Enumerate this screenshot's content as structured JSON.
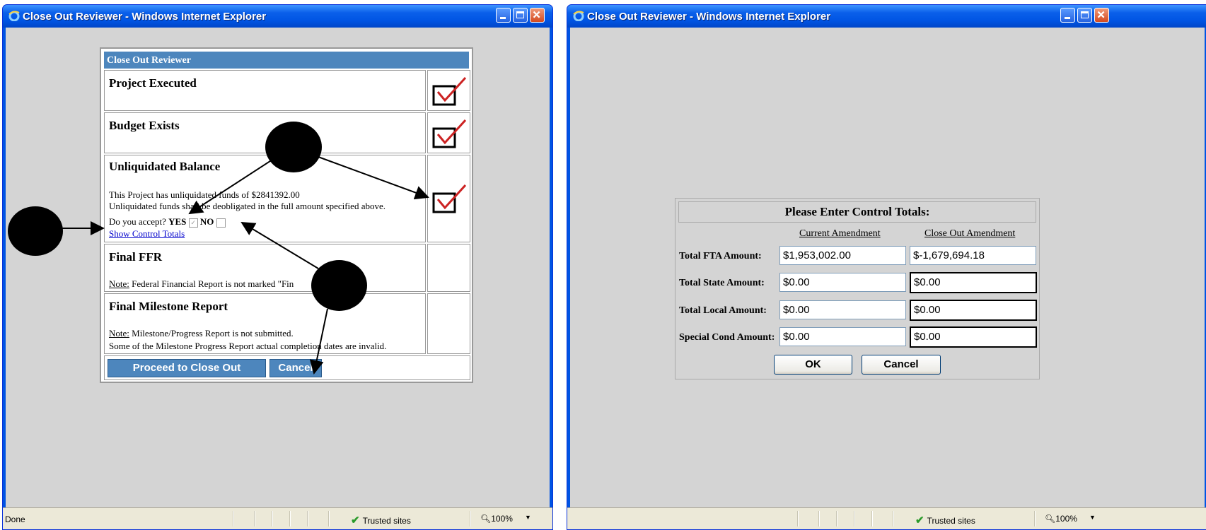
{
  "left_window": {
    "title": "Close Out Reviewer - Windows Internet Explorer",
    "dialog_header": "Close Out Reviewer",
    "rows": {
      "project_executed": "Project Executed",
      "budget_exists": "Budget Exists",
      "unliquidated_balance": "Unliquidated Balance",
      "unliquidated_text1": "This Project has unliquidated funds of $2841392.00",
      "unliquidated_text2": "Unliquidated funds shall be deobligated in the full amount specified above.",
      "accept_question": "Do you accept?",
      "yes_label": "YES",
      "no_label": "NO",
      "show_control_totals": "Show Control Totals",
      "final_ffr": "Final FFR",
      "note_label": "Note:",
      "ffr_note": "Federal Financial Report is not marked \"Fin",
      "final_milestone": "Final Milestone Report",
      "milestone_note1": "Milestone/Progress Report is not submitted.",
      "milestone_note2": "Some of the Milestone Progress Report actual completion dates are invalid."
    },
    "buttons": {
      "proceed": "Proceed to Close Out",
      "cancel": "Cancel"
    },
    "status": {
      "done": "Done",
      "zone": "Trusted sites",
      "zoom": "100%"
    }
  },
  "right_window": {
    "title": "Close Out Reviewer - Windows Internet Explorer",
    "form_title": "Please Enter Control Totals:",
    "col_current": "Current Amendment",
    "col_closeout": "Close Out Amendment",
    "rows": [
      {
        "label": "Total FTA Amount:",
        "current": "$1,953,002.00",
        "closeout": "$-1,679,694.18"
      },
      {
        "label": "Total State Amount:",
        "current": "$0.00",
        "closeout": "$0.00"
      },
      {
        "label": "Total Local Amount:",
        "current": "$0.00",
        "closeout": "$0.00"
      },
      {
        "label": "Special Cond Amount:",
        "current": "$0.00",
        "closeout": "$0.00"
      }
    ],
    "buttons": {
      "ok": "OK",
      "cancel": "Cancel"
    },
    "status": {
      "zone": "Trusted sites",
      "zoom": "100%"
    }
  },
  "icons": [
    "ie-logo-icon",
    "minimize-icon",
    "maximize-icon",
    "close-icon",
    "checkmark-icon",
    "trusted-sites-check-icon",
    "zoom-icon",
    "annotation-dot",
    "annotation-arrow"
  ],
  "colors": {
    "title_bar": "#0054e3",
    "dialog_header": "#4d86bd",
    "content_bg": "#d4d4d4",
    "check_red": "#cc2222"
  }
}
